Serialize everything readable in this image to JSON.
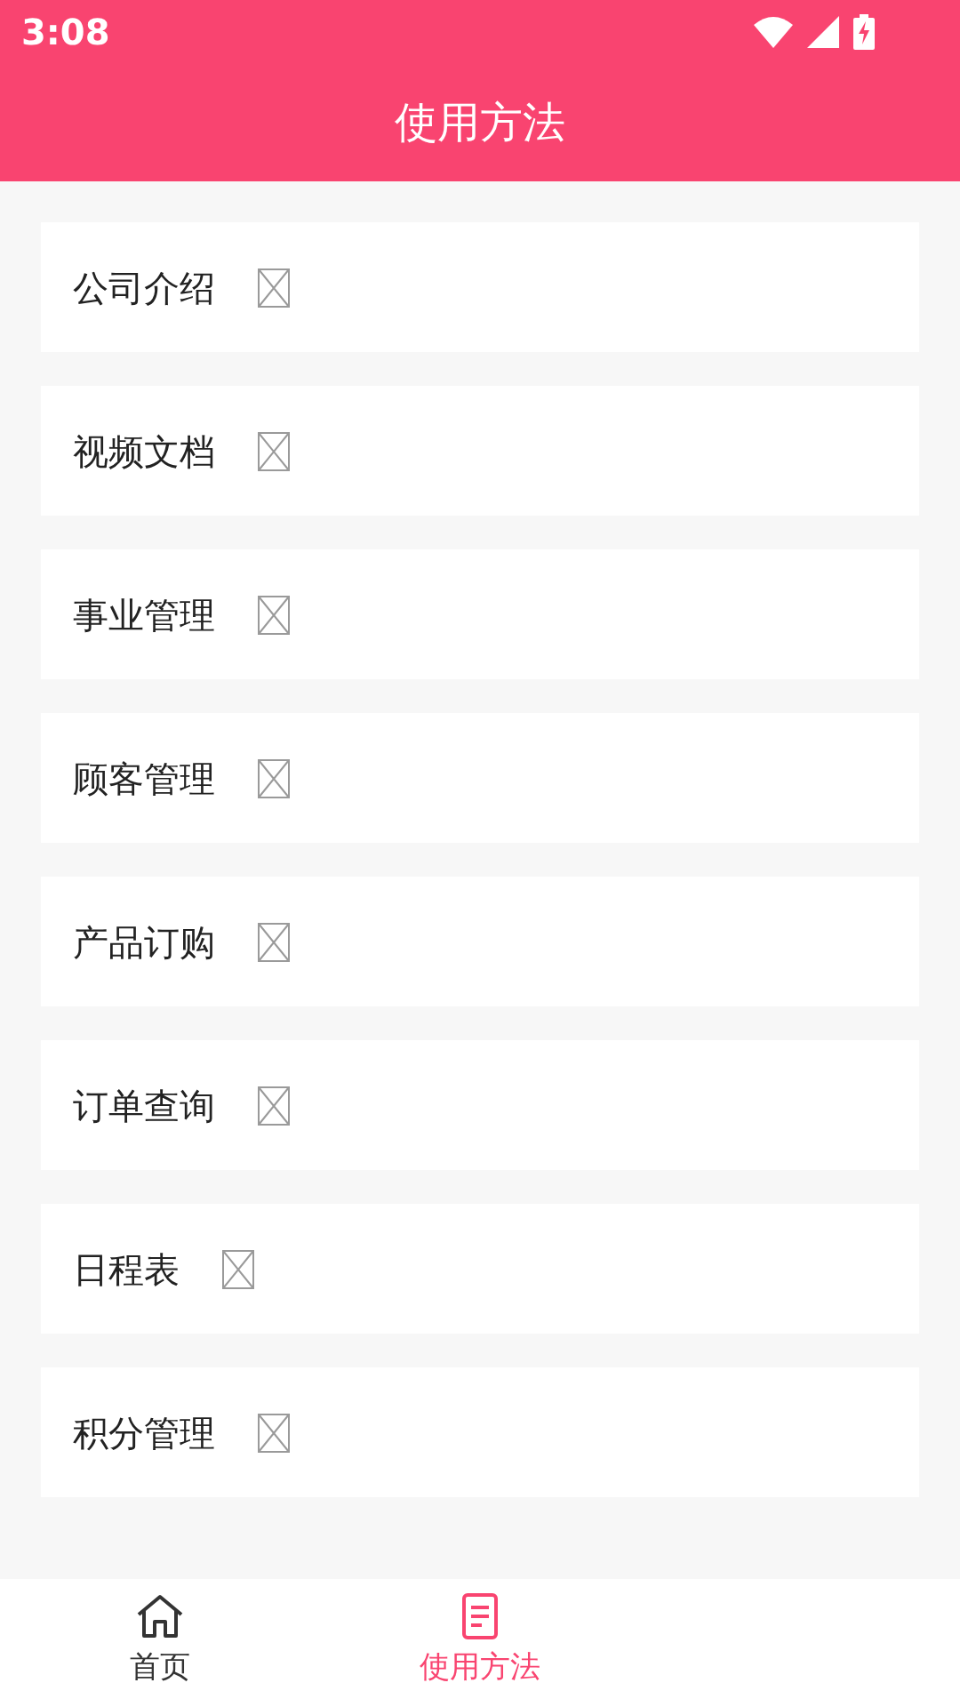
{
  "status_bar": {
    "time": "3:08"
  },
  "header": {
    "title": "使用方法"
  },
  "items": [
    {
      "label": "公司介绍"
    },
    {
      "label": "视频文档"
    },
    {
      "label": "事业管理"
    },
    {
      "label": "顾客管理"
    },
    {
      "label": "产品订购"
    },
    {
      "label": "订单查询"
    },
    {
      "label": "日程表"
    },
    {
      "label": "积分管理"
    }
  ],
  "bottom_nav": [
    {
      "label": "首页",
      "kind": "home",
      "selected": false
    },
    {
      "label": "使用方法",
      "kind": "guide",
      "selected": true
    }
  ]
}
